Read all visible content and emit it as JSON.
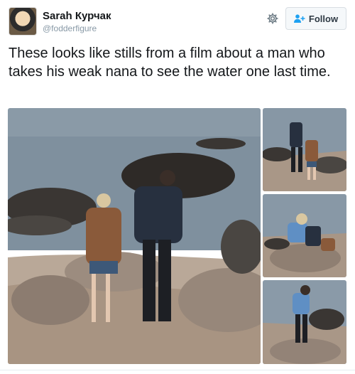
{
  "user": {
    "display_name": "Sarah Курчак",
    "handle": "@fodderfigure"
  },
  "actions": {
    "follow_label": "Follow"
  },
  "tweet": {
    "text": "These looks like stills from a film about a man who takes his weak nana to see the water one last time."
  },
  "icons": {
    "settings": "gear-icon",
    "follow": "add-user-icon"
  },
  "colors": {
    "text": "#14171a",
    "secondary_text": "#8899a6",
    "follow_icon": "#1da1f2",
    "button_border": "#d8dee3"
  }
}
